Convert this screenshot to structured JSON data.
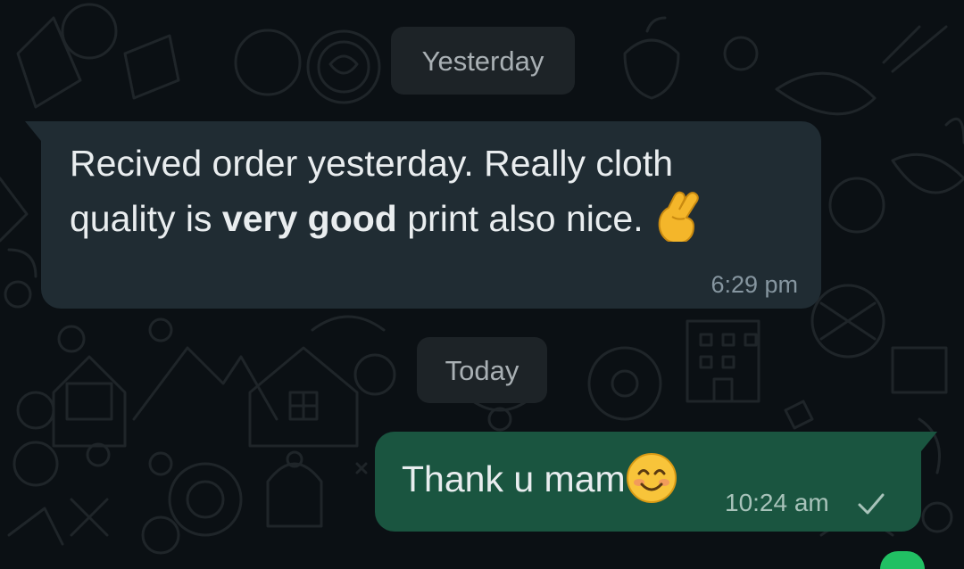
{
  "chat": {
    "date_separators": {
      "yesterday": "Yesterday",
      "today": "Today"
    },
    "messages": [
      {
        "direction": "incoming",
        "text_part1": "Recived order yesterday. Really cloth quality is ",
        "text_bold": "very good",
        "text_part2": " print also nice.",
        "emoji": "crossed-fingers-emoji",
        "time": "6:29 pm"
      },
      {
        "direction": "outgoing",
        "text": "Thank u mam",
        "emoji": "smiling-face-emoji",
        "time": "10:24 am",
        "status": "sent-check-icon"
      }
    ]
  },
  "colors": {
    "background": "#0b1014",
    "incoming_bubble": "#202c33",
    "outgoing_bubble": "#1a5540",
    "date_chip": "#1d2327",
    "text": "#e9edef",
    "meta_text": "#8696a0"
  }
}
